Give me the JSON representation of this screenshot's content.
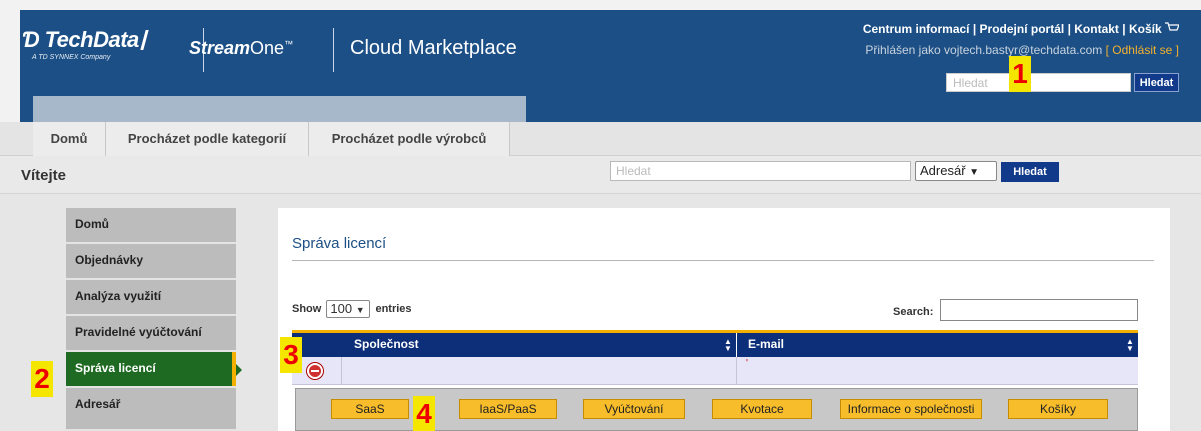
{
  "header": {
    "brand_techdata": "TechData",
    "brand_sub": "A TD SYNNEX Company",
    "brand_streamone_bold": "Stream",
    "brand_streamone_rest": "One",
    "brand_tm": "™",
    "brand_marketplace": "Cloud Marketplace",
    "links": [
      "Centrum informací",
      "Prodejní portál",
      "Kontakt",
      "Košík"
    ],
    "link_separator": " | ",
    "login_text": "Přihlášen jako vojtech.bastyr@techdata.com",
    "logout": "[ Odhlásit se ]",
    "search_placeholder": "Hledat",
    "search_button": "Hledat"
  },
  "nav": {
    "items": [
      "Domů",
      "Procházet podle kategorií",
      "Procházet podle výrobců"
    ]
  },
  "welcome": {
    "title": "Vítejte",
    "search_placeholder": "Hledat",
    "select_value": "Adresář",
    "search_button": "Hledat"
  },
  "sidebar": {
    "items": [
      "Domů",
      "Objednávky",
      "Analýza využití",
      "Pravidelné vyúčtování",
      "Správa licencí",
      "Adresář"
    ],
    "active_index": 4
  },
  "main": {
    "title": "Správa licencí",
    "show_label": "Show",
    "show_value": "100",
    "entries_label": "entries",
    "search_label": "Search:",
    "columns": [
      "Společnost",
      "E-mail"
    ],
    "row": {
      "company": "",
      "email": "'"
    },
    "buttons": [
      "SaaS",
      "IaaS/PaaS",
      "Vyúčtování",
      "Kvotace",
      "Informace o společnosti",
      "Košíky"
    ]
  },
  "badges": [
    "1",
    "2",
    "3",
    "4"
  ],
  "colors": {
    "header_blue": "#1b4f86",
    "active_green": "#1e6a22",
    "accent_yellow": "#f4b000",
    "table_head": "#0d2f7a"
  }
}
